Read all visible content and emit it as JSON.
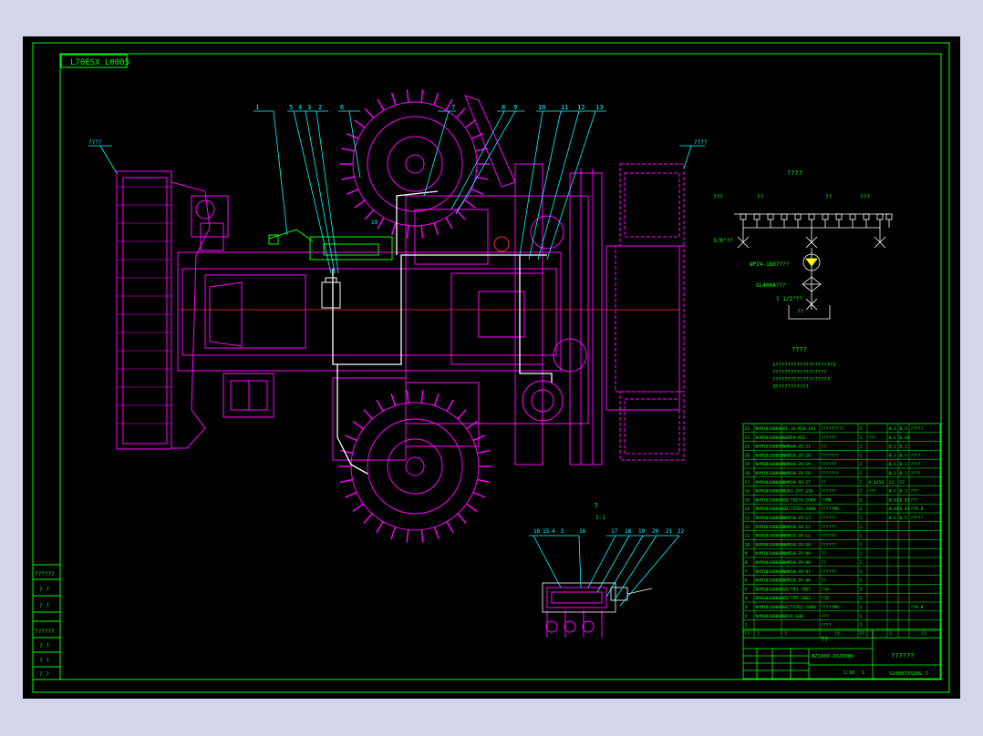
{
  "colors": {
    "frame_outer": "#d4d4ea",
    "canvas": "#000000",
    "border": "#00ff00",
    "machine": "#ff00ff",
    "leader": "#00ffff",
    "hose": "#ffffff",
    "accent_red": "#ff3030",
    "lamp": "#ffff00"
  },
  "drawing": {
    "stamp_label": "L70ESX L0005",
    "left_label": "????",
    "right_label": "????",
    "section_label": "?",
    "section_sub": "1-1",
    "callouts_top": [
      "1",
      "5",
      "4",
      "3",
      "2",
      "6",
      "7",
      "8",
      "9",
      "10",
      "11",
      "12",
      "13"
    ],
    "callouts_bottom": [
      "16",
      "15",
      "4",
      "5",
      "16",
      "17",
      "18",
      "19",
      "20",
      "21",
      "22"
    ],
    "note_19": "19",
    "hydraulic": {
      "title": "????",
      "group_label_1": "???",
      "group_label_2": "??",
      "group_label_3": "??",
      "group_label_4": "???",
      "valve_label": "3/8\"??",
      "pump_label": "WPZ4-1B07???",
      "filter_label": "SL400A???",
      "pipe_label": "1 1/2\"??",
      "tank_label": "??"
    },
    "notes": {
      "title": "????",
      "lines": [
        "1???????????????????1",
        "??????????????????",
        "???????????????????",
        "3???????????"
      ]
    }
  },
  "bom": {
    "rows": [
      [
        "23",
        "NXM10100000",
        "XT-16-M10-19S",
        "?????????",
        "1",
        "",
        "0.1",
        "0.5",
        "?????"
      ],
      [
        "22",
        "NXM10100000",
        "GB859-M12",
        "??????",
        "1",
        "???",
        "0.1",
        "0.01",
        ""
      ],
      [
        "21",
        "NXM10100000",
        "NXM10-ZH-21",
        "??",
        "1",
        "",
        "0.1",
        "0.1",
        ""
      ],
      [
        "20",
        "NXM10100000",
        "NXM10-ZH-20",
        "???????",
        "1",
        "",
        "0.1",
        "0.5",
        "????"
      ],
      [
        "19",
        "NXM10100000",
        "NXM10-ZH-19",
        "??????",
        "1",
        "",
        "0.1",
        "0.1",
        "????"
      ],
      [
        "18",
        "NXM10100000",
        "NXM10-ZH-18",
        "???????",
        "1",
        "",
        "0.1",
        "0.1",
        "????"
      ],
      [
        "17",
        "NXM10100000",
        "NXM10-ZH-17",
        "??",
        "1",
        "0.0354",
        "12",
        "12",
        ""
      ],
      [
        "16",
        "NXM10100000",
        "BU01-297-256",
        "??????",
        "2",
        "???",
        "0.1",
        "0.2",
        "???"
      ],
      [
        "15",
        "NXM10100000",
        "GB/T6170-2000",
        "??M8",
        "3",
        "",
        "0.01",
        "0.03",
        "???"
      ],
      [
        "14",
        "NXM10100000",
        "GB/T5783-2000",
        "?????M8",
        "3",
        "",
        "0.01",
        "0.03",
        "??8.8"
      ],
      [
        "13",
        "NXM10100000",
        "NXM10-ZH-13",
        "??????",
        "1",
        "",
        "0.1",
        "0.5",
        "?????"
      ],
      [
        "12",
        "NXM10100000",
        "NXM10-ZH-12",
        "??????",
        "1",
        "",
        "",
        "",
        ""
      ],
      [
        "11",
        "NXM10100000",
        "NXM10-ZH-11",
        "??????",
        "1",
        "",
        "",
        "",
        ""
      ],
      [
        "10",
        "NXM10100000",
        "NXM10-ZH-10",
        "??????",
        "1",
        "",
        "",
        "",
        ""
      ],
      [
        "9",
        "NXM10100000",
        "NXM10-ZH-09",
        "??",
        "1",
        "",
        "",
        "",
        ""
      ],
      [
        "8",
        "NXM10100000",
        "NXM10-ZH-08",
        "??",
        "1",
        "",
        "",
        "",
        ""
      ],
      [
        "7",
        "NXM10100000",
        "NXM10-ZH-07",
        "??????",
        "1",
        "",
        "",
        "",
        ""
      ],
      [
        "6",
        "NXM10100000",
        "NXM10-ZH-06",
        "??",
        "1",
        "",
        "",
        "",
        ""
      ],
      [
        "5",
        "NXM10100000",
        "GB/T93-1987",
        "??8",
        "3",
        "",
        "",
        "",
        ""
      ],
      [
        "4",
        "NXM10100000",
        "GB/T95-2002",
        "??8",
        "3",
        "",
        "",
        "",
        ""
      ],
      [
        "3",
        "NXM10100000",
        "GB/T5782-2000",
        "?????M8",
        "3",
        "",
        "",
        "",
        "??8.8"
      ],
      [
        "2",
        "NXM10100000",
        "WPZ4-100",
        "???",
        "1",
        "",
        "",
        "",
        ""
      ],
      [
        "1",
        "",
        "",
        "????",
        "1",
        "",
        "",
        "",
        ""
      ]
    ],
    "header": [
      "??",
      "?",
      "?",
      "??",
      "??",
      "?",
      "?",
      "??"
    ],
    "title_center": "??",
    "drawing_no": "NZ1000-XXZ0000",
    "title_right": "??????",
    "drawing_code": "S1000TXS30L 7",
    "scale": "1:10",
    "sheet": "1"
  },
  "side_table": {
    "labels": [
      "??????",
      "? ?",
      "? ?",
      "??????",
      "? ?",
      "? ?",
      "? ?"
    ]
  }
}
